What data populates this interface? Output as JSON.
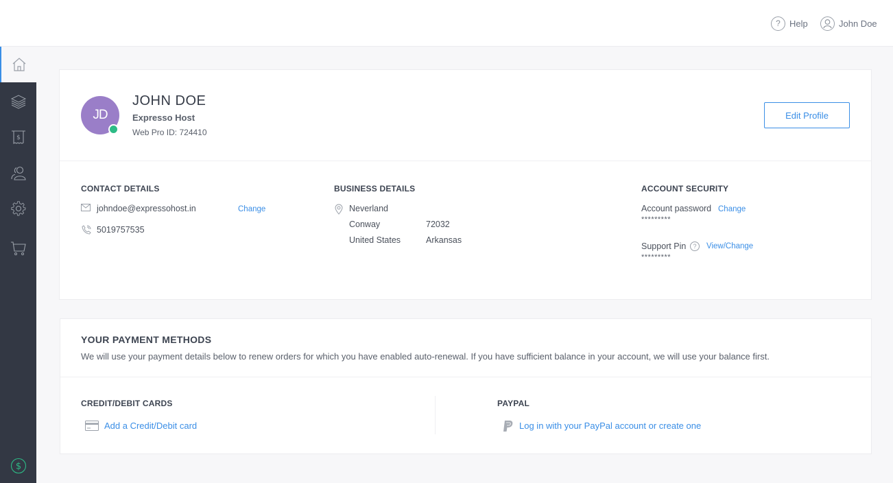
{
  "header": {
    "help_label": "Help",
    "user_label": "John Doe"
  },
  "sidebar": {
    "items": [
      {
        "name": "home",
        "icon": "home-icon",
        "active": true
      },
      {
        "name": "products",
        "icon": "layers-icon",
        "active": false
      },
      {
        "name": "billing",
        "icon": "receipt-icon",
        "active": false
      },
      {
        "name": "customers",
        "icon": "users-icon",
        "active": false
      },
      {
        "name": "settings",
        "icon": "gear-icon",
        "active": false
      },
      {
        "name": "cart",
        "icon": "cart-icon",
        "active": false
      }
    ],
    "bottom_icon": "dollar-circle-icon"
  },
  "profile": {
    "initials": "JD",
    "name": "JOHN DOE",
    "company": "Expresso Host",
    "web_pro_id": "Web Pro ID: 724410",
    "online": true,
    "edit_button": "Edit Profile"
  },
  "contact": {
    "title": "CONTACT DETAILS",
    "email": "johndoe@expressohost.in",
    "email_change": "Change",
    "phone": "5019757535"
  },
  "business": {
    "title": "BUSINESS DETAILS",
    "address_line1": "Neverland",
    "city": "Conway",
    "zip": "72032",
    "country": "United States",
    "state": "Arkansas"
  },
  "security": {
    "title": "ACCOUNT SECURITY",
    "password_label": "Account password",
    "password_change": "Change",
    "password_mask": "*********",
    "pin_label": "Support Pin",
    "pin_change": "View/Change",
    "pin_mask": "*********"
  },
  "payment": {
    "title": "YOUR PAYMENT METHODS",
    "description": "We will use your payment details below to renew orders for which you have enabled auto-renewal. If you have sufficient balance in your account, we will use your balance first.",
    "cards_title": "CREDIT/DEBIT CARDS",
    "add_card": "Add a Credit/Debit card",
    "paypal_title": "PAYPAL",
    "paypal_link": "Log in with your PayPal account or create one"
  },
  "colors": {
    "accent": "#3a8ee6",
    "sidebar": "#333844",
    "avatar": "#9a7ec8",
    "online": "#2dbb86"
  }
}
